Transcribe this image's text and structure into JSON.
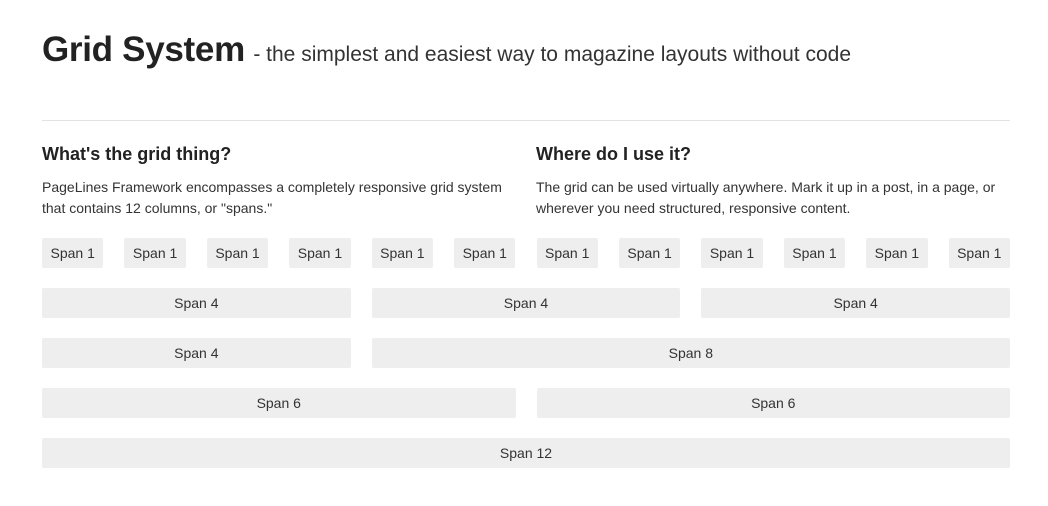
{
  "header": {
    "title": "Grid System",
    "subtitle": "- the simplest and easiest way to magazine layouts without code"
  },
  "columns": [
    {
      "heading": "What's the grid thing?",
      "text": "PageLines Framework encompasses a completely responsive grid system that contains 12 columns, or \"spans.\""
    },
    {
      "heading": "Where do I use it?",
      "text": "The grid can be used virtually anywhere. Mark it up in a post, in a page, or wherever you need structured, responsive content."
    }
  ],
  "grid": {
    "rows": [
      [
        {
          "label": "Span 1",
          "span": 1
        },
        {
          "label": "Span 1",
          "span": 1
        },
        {
          "label": "Span 1",
          "span": 1
        },
        {
          "label": "Span 1",
          "span": 1
        },
        {
          "label": "Span 1",
          "span": 1
        },
        {
          "label": "Span 1",
          "span": 1
        },
        {
          "label": "Span 1",
          "span": 1
        },
        {
          "label": "Span 1",
          "span": 1
        },
        {
          "label": "Span 1",
          "span": 1
        },
        {
          "label": "Span 1",
          "span": 1
        },
        {
          "label": "Span 1",
          "span": 1
        },
        {
          "label": "Span 1",
          "span": 1
        }
      ],
      [
        {
          "label": "Span 4",
          "span": 4
        },
        {
          "label": "Span 4",
          "span": 4
        },
        {
          "label": "Span 4",
          "span": 4
        }
      ],
      [
        {
          "label": "Span 4",
          "span": 4
        },
        {
          "label": "Span 8",
          "span": 8
        }
      ],
      [
        {
          "label": "Span 6",
          "span": 6
        },
        {
          "label": "Span 6",
          "span": 6
        }
      ],
      [
        {
          "label": "Span 12",
          "span": 12
        }
      ]
    ]
  }
}
